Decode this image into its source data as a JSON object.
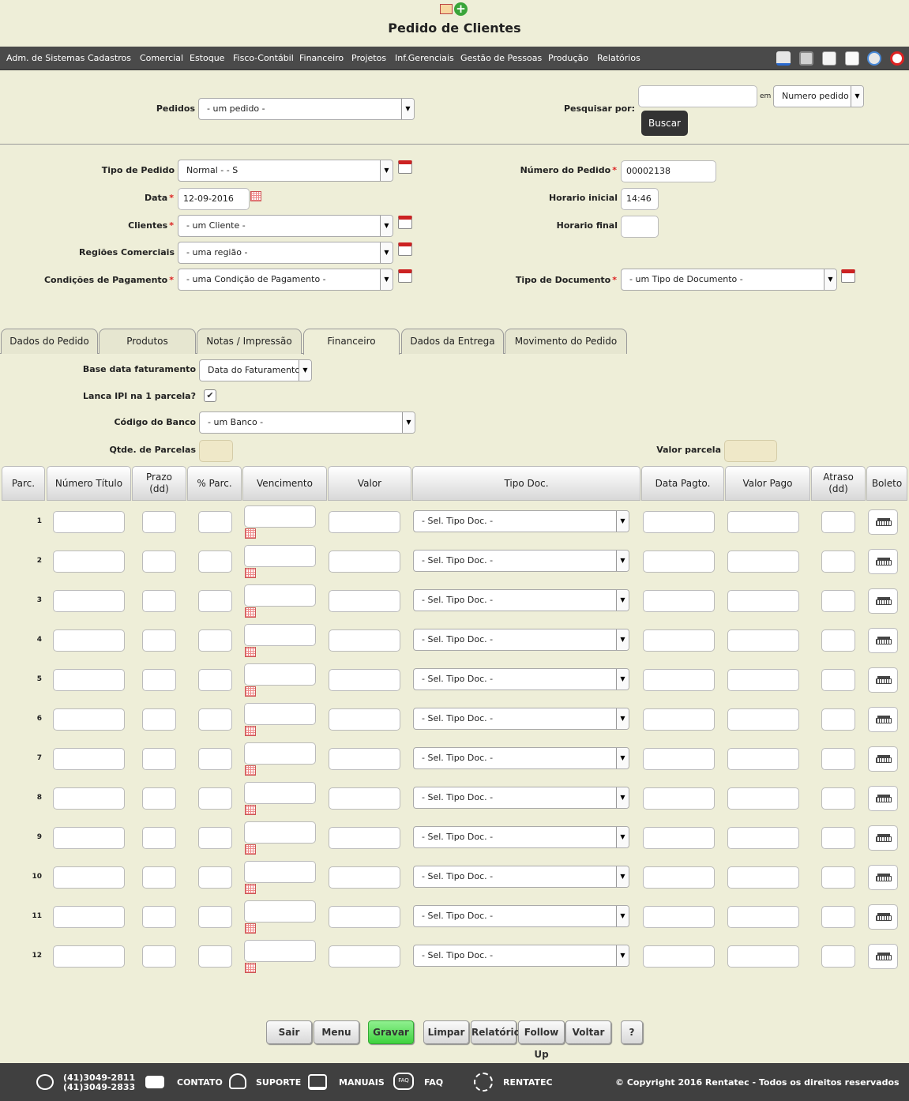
{
  "page_title": "Pedido de Clientes",
  "menu": [
    "Adm. de Sistemas",
    "Cadastros",
    "Comercial",
    "Estoque",
    "Fisco-Contábil",
    "Financeiro",
    "Projetos",
    "Inf.Gerenciais",
    "Gestão de Pessoas",
    "Produção",
    "Relatórios"
  ],
  "search": {
    "pedidos_label": "Pedidos",
    "pedidos_value": "- um pedido -",
    "pesquisar_label": "Pesquisar por:",
    "query_value": "",
    "em_label": "em",
    "field_value": "Numero pedido",
    "buscar_label": "Buscar"
  },
  "form": {
    "tipo_pedido_label": "Tipo de Pedido",
    "tipo_pedido_value": "Normal - - S",
    "data_label": "Data",
    "data_value": "12-09-2016",
    "clientes_label": "Clientes",
    "clientes_value": "- um Cliente -",
    "regioes_label": "Regiões Comerciais",
    "regioes_value": "- uma região -",
    "condicoes_label": "Condições de Pagamento",
    "condicoes_value": "- uma Condição de Pagamento -",
    "numero_label": "Número do Pedido",
    "numero_value": "00002138",
    "hora_inicial_label": "Horario inicial",
    "hora_inicial_value": "14:46",
    "hora_final_label": "Horario final",
    "hora_final_value": "",
    "tipo_doc_label": "Tipo de Documento",
    "tipo_doc_value": "- um Tipo de Documento -"
  },
  "tabs": [
    "Dados do Pedido",
    "Produtos",
    "Notas / Impressão",
    "Financeiro",
    "Dados da Entrega",
    "Movimento do Pedido"
  ],
  "active_tab": "Financeiro",
  "financeiro": {
    "base_label": "Base data faturamento",
    "base_value": "Data do Faturamento",
    "ipi_label": "Lanca IPI na 1 parcela?",
    "ipi_checked": true,
    "banco_label": "Código do Banco",
    "banco_value": "- um Banco -",
    "qtde_label": "Qtde. de Parcelas",
    "valor_parcela_label": "Valor parcela"
  },
  "table": {
    "headers": [
      "Parc.",
      "Número Título",
      "Prazo (dd)",
      "% Parc.",
      "Vencimento",
      "Valor",
      "Tipo Doc.",
      "Data Pagto.",
      "Valor Pago",
      "Atraso (dd)",
      "Boleto"
    ],
    "rows": [
      "1",
      "2",
      "3",
      "4",
      "5",
      "6",
      "7",
      "8",
      "9",
      "10",
      "11",
      "12"
    ],
    "tipo_doc_default": "- Sel. Tipo Doc. -"
  },
  "buttons": [
    "Sair",
    "Menu",
    "Gravar",
    "Limpar",
    "Relatório",
    "Follow Up",
    "Voltar",
    "?"
  ],
  "footer": {
    "phone1": "(41)3049-2811",
    "phone2": "(41)3049-2833",
    "contato": "CONTATO",
    "suporte": "SUPORTE",
    "manuais": "MANUAIS",
    "faq_icon_text": "FAQ",
    "faq": "FAQ",
    "rentatec": "RENTATEC",
    "copyright": "© Copyright 2016 Rentatec - Todos os direitos reservados"
  },
  "colors": {
    "background": "#eeeed8",
    "menubar": "#4a4a4a",
    "footer": "#404040",
    "gravar": "#4fdc4f"
  }
}
